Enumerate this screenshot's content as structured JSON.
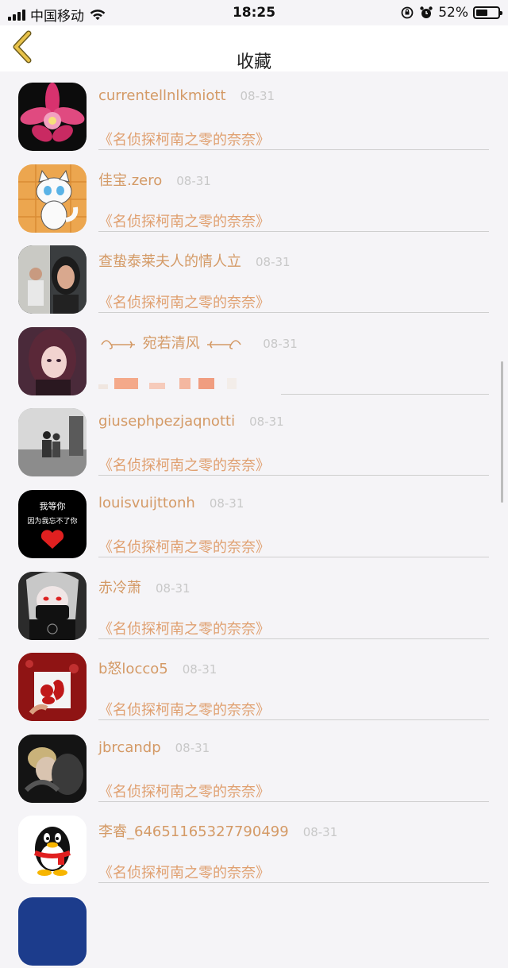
{
  "status": {
    "carrier": "中国移动",
    "time": "18:25",
    "battery": "52%",
    "battery_level": 0.52
  },
  "nav": {
    "title": "收藏"
  },
  "items": [
    {
      "name": "currentellnlkmiott",
      "date": "08-31",
      "subtitle": "《名侦探柯南之零的奈奈》",
      "avatar": "orchid-flower"
    },
    {
      "name": "佳宝.zero",
      "date": "08-31",
      "subtitle": "《名侦探柯南之零的奈奈》",
      "avatar": "cartoon-cat"
    },
    {
      "name": "查蛰泰莱夫人的情人立",
      "date": "08-31",
      "subtitle": "《名侦探柯南之零的奈奈》",
      "avatar": "couple-photo"
    },
    {
      "name": "宛若清风",
      "date": "08-31",
      "subtitle": "",
      "avatar": "girl-portrait",
      "decorated": true
    },
    {
      "name": "giuseph​pezjaqnotti",
      "date": "08-31",
      "subtitle": "《名侦探柯南之零的奈奈》",
      "avatar": "couple-seaside"
    },
    {
      "name": "louisvuijttonh",
      "date": "08-31",
      "subtitle": "《名侦探柯南之零的奈奈》",
      "avatar": "black-heart-text",
      "avatar_text": [
        "我等你",
        "因为我忘不了你"
      ]
    },
    {
      "name": "赤冷萧",
      "date": "08-31",
      "subtitle": "《名侦探柯南之零的奈奈》",
      "avatar": "anime-masked"
    },
    {
      "name": "b怒locco5",
      "date": "08-31",
      "subtitle": "《名侦探柯南之零的奈奈》",
      "avatar": "red-squirrel"
    },
    {
      "name": "jbrcandp",
      "date": "08-31",
      "subtitle": "《名侦探柯南之零的奈奈》",
      "avatar": "dark-photo"
    },
    {
      "name": "李睿_64651165327790499",
      "date": "08-31",
      "subtitle": "《名侦探柯南之零的奈奈》",
      "avatar": "qq-penguin"
    }
  ],
  "colors": {
    "accent": "#d49a66",
    "date": "#c8c8c8",
    "background": "#f5f4f7"
  }
}
